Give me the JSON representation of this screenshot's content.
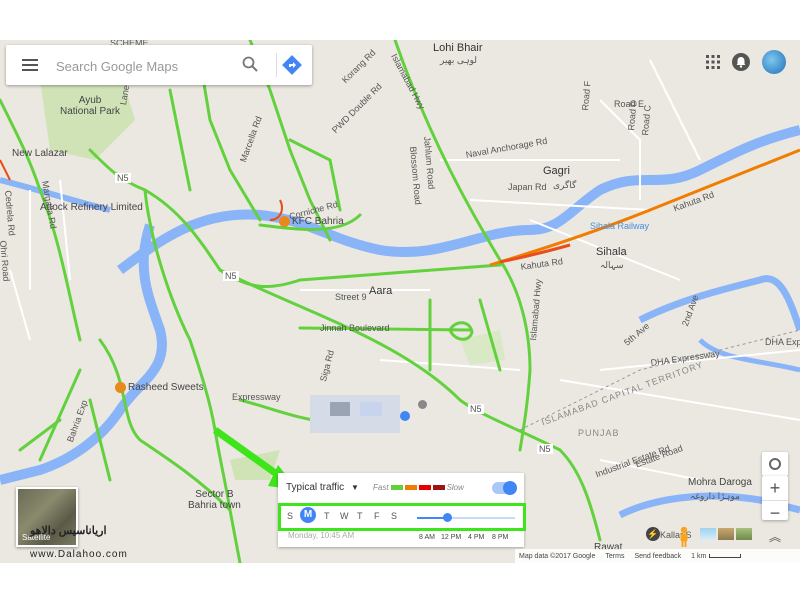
{
  "search": {
    "placeholder": "Search Google Maps"
  },
  "map_labels": {
    "scheme": "SCHEME",
    "lohi_bhair": "Lohi Bhair",
    "lohi_bhair_urdu": "لوہی بھیر",
    "ayub_park": "Ayub\nNational Park",
    "new_lalazar": "New Lalazar",
    "attock": "Attock Refinery Limited",
    "kfc": "KFC Bahria",
    "aara": "Aara",
    "rasheed": "Rasheed Sweets",
    "sector_b": "Sector B\nBahria town",
    "gagri": "Gagri",
    "gagri_urdu": "گاگری",
    "sihala_railway": "Sihala Railway",
    "sihala": "Sihala",
    "sihala_urdu": "سہالہ",
    "kahuta_rd": "Kahuta Rd",
    "kahuta_rd2": "Kahuta Rd",
    "islamabad_hwy": "Islamabad Hwy",
    "islamabad_hwy2": "Islamabad Hwy",
    "pwd_road": "PWD Double Rd",
    "naval_anchorage": "Naval Anchorage Rd",
    "japan_rd": "Japan Rd",
    "blossom_road": "Blossom Road",
    "jahlum_road": "Jahlum Road",
    "korang_rd": "Korang Rd",
    "street9": "Street 9",
    "jinnah_blvd": "Jinnah Boulevard",
    "siga_rd": "Siga Rd",
    "expressway": "Expressway",
    "bahria_exp": "Bahria Exp",
    "dha_expressway": "DHA Expressway",
    "dha_exp": "DHA Expre",
    "fifth_ave": "5th Ave",
    "second_ave": "2nd Ave",
    "ict": "ISLAMABAD CAPITAL TERRITORY",
    "punjab": "PUNJAB",
    "n5_a": "N5",
    "n5_b": "N5",
    "n5_c": "N5",
    "n5_d": "N5",
    "margalla": "Margalla Rd",
    "road_e": "Road E",
    "road_f": "Road F",
    "road_d": "Road D",
    "road_c": "Road C",
    "mohra": "Mohra Daroga",
    "mohra_urdu": "موہڑا داروغہ",
    "estate_road": "Estate Road",
    "industrial": "Industrial Estate Rd",
    "rawat": "Rawat",
    "kallar": "Kallar S",
    "lane7": "Lane 7",
    "ohri_road": "Ohri Road",
    "cedrela": "Cedrela Rd",
    "cornice": "Corniche Rd",
    "marcella": "Marcella Rd"
  },
  "traffic": {
    "mode": "Typical traffic",
    "fast": "Fast",
    "slow": "Slow",
    "days": [
      "S",
      "M",
      "T",
      "W",
      "T",
      "F",
      "S"
    ],
    "selected_day_index": 1,
    "datetime": "Monday, 10:45 AM",
    "hours": [
      "8 AM",
      "12 PM",
      "4 PM",
      "8 PM"
    ],
    "slider_position": 0.3
  },
  "satellite_label": "Satellite",
  "footer": {
    "map_data": "Map data ©2017 Google",
    "terms": "Terms",
    "feedback": "Send feedback",
    "scale": "1 km"
  },
  "watermark": {
    "line1": "اریاناسیس دالاهو",
    "line2": "www.Dalahoo.com"
  },
  "colors": {
    "map_bg": "#ebe8e1",
    "water": "#8ab4f8",
    "traffic_green": "#63d13e",
    "traffic_orange": "#f07d02",
    "accent": "#4285f4",
    "highlight": "#3ee51a"
  }
}
